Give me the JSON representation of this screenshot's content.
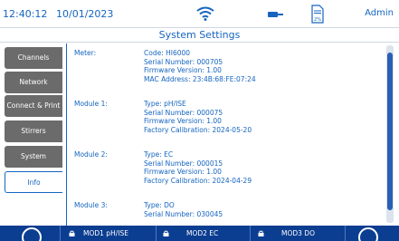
{
  "status": {
    "time": "12:40:12",
    "date": "10/01/2023",
    "storage_percent": "2%",
    "user": "Admin",
    "icons": [
      "wifi-icon",
      "probe-icon",
      "storage-icon"
    ]
  },
  "title": "System Settings",
  "tabs": [
    {
      "label": "Channels",
      "active": false
    },
    {
      "label": "Network",
      "active": false
    },
    {
      "label": "Connect & Print",
      "active": false
    },
    {
      "label": "Stirrers",
      "active": false
    },
    {
      "label": "System",
      "active": false
    },
    {
      "label": "Info",
      "active": true
    }
  ],
  "info": [
    {
      "label": "Meter:",
      "lines": [
        "Code: HI6000",
        "Serial Number: 000705",
        "Firmware Version: 1.00",
        "MAC Address: 23:4B:68:FE:07:24"
      ]
    },
    {
      "label": "Module 1:",
      "lines": [
        "Type: pH/ISE",
        "Serial Number: 000075",
        "Firmware Version: 1.00",
        "Factory Calibration: 2024-05-20"
      ]
    },
    {
      "label": "Module 2:",
      "lines": [
        "Type: EC",
        "Serial Number: 000015",
        "Firmware Version: 1.00",
        "Factory Calibration: 2024-04-29"
      ]
    },
    {
      "label": "Module 3:",
      "lines": [
        "Type: DO",
        "Serial Number: 030045"
      ]
    }
  ],
  "bottom": {
    "modules": [
      "MOD1 pH/ISE",
      "MOD2 EC",
      "MOD3 DO"
    ]
  },
  "colors": {
    "accent": "#1565c0",
    "tab_inactive": "#6b6b6b",
    "bottom_bar": "#0b3d91"
  }
}
